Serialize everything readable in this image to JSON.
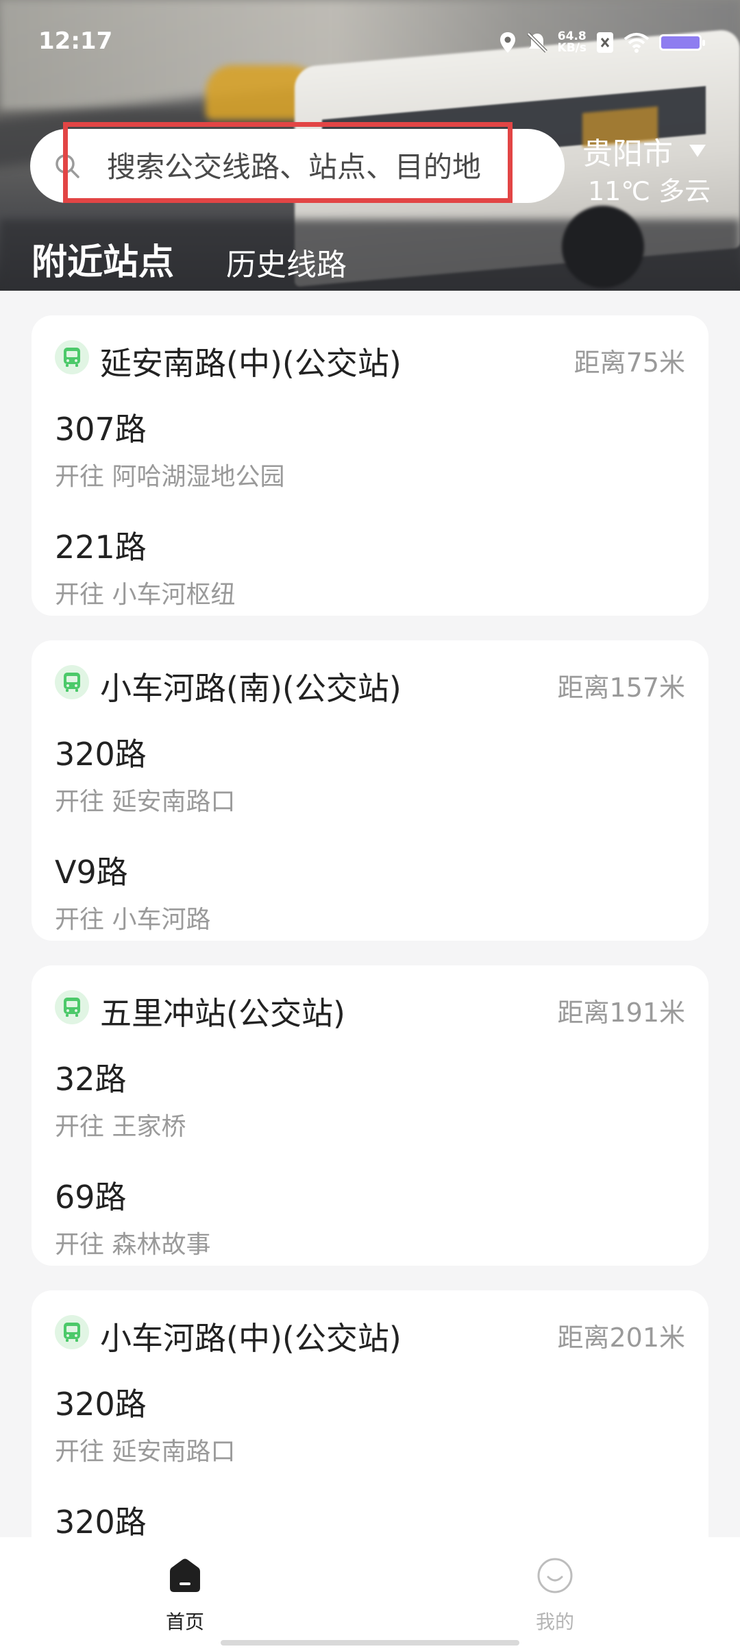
{
  "status_bar": {
    "time": "12:17",
    "net_speed_value": "64.8",
    "net_speed_unit": "KB/s"
  },
  "search": {
    "placeholder": "搜索公交线路、站点、目的地"
  },
  "location": {
    "city": "贵阳市",
    "weather": "11℃ 多云"
  },
  "tabs": [
    {
      "label": "附近站点",
      "active": true
    },
    {
      "label": "历史线路",
      "active": false
    }
  ],
  "stations": [
    {
      "name": "延安南路(中)(公交站)",
      "distance": "距离75米",
      "routes": [
        {
          "name": "307路",
          "destination": "开往 阿哈湖湿地公园"
        },
        {
          "name": "221路",
          "destination": "开往 小车河枢纽"
        }
      ]
    },
    {
      "name": "小车河路(南)(公交站)",
      "distance": "距离157米",
      "routes": [
        {
          "name": "320路",
          "destination": "开往 延安南路口"
        },
        {
          "name": "V9路",
          "destination": "开往 小车河路"
        }
      ]
    },
    {
      "name": "五里冲站(公交站)",
      "distance": "距离191米",
      "routes": [
        {
          "name": "32路",
          "destination": "开往 王家桥"
        },
        {
          "name": "69路",
          "destination": "开往 森林故事"
        }
      ]
    },
    {
      "name": "小车河路(中)(公交站)",
      "distance": "距离201米",
      "routes": [
        {
          "name": "320路",
          "destination": "开往 延安南路口"
        },
        {
          "name": "320路",
          "destination": ""
        }
      ]
    }
  ],
  "bottom_nav": {
    "home_label": "首页",
    "mine_label": "我的"
  },
  "colors": {
    "accent_green": "#4cc96a",
    "highlight_red": "#e24545",
    "background": "#f5f5f6"
  }
}
